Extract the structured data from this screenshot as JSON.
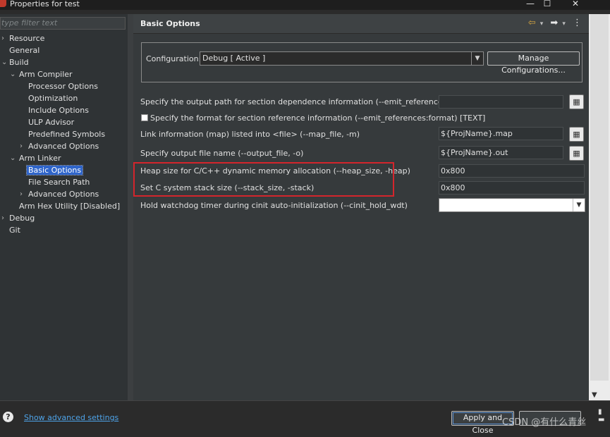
{
  "window": {
    "title": "Properties for test",
    "minimize": "—",
    "maximize": "☐",
    "close": "✕"
  },
  "sidebar": {
    "filter_placeholder": "type filter text",
    "items": [
      {
        "label": "Resource",
        "twisty": "›"
      },
      {
        "label": "General",
        "twisty": ""
      },
      {
        "label": "Build",
        "twisty": "⌄"
      },
      {
        "label": "Arm Compiler",
        "twisty": "⌄"
      },
      {
        "label": "Processor Options",
        "twisty": ""
      },
      {
        "label": "Optimization",
        "twisty": ""
      },
      {
        "label": "Include Options",
        "twisty": ""
      },
      {
        "label": "ULP Advisor",
        "twisty": ""
      },
      {
        "label": "Predefined Symbols",
        "twisty": ""
      },
      {
        "label": "Advanced Options",
        "twisty": "›"
      },
      {
        "label": "Arm Linker",
        "twisty": "⌄"
      },
      {
        "label": "Basic Options",
        "twisty": ""
      },
      {
        "label": "File Search Path",
        "twisty": ""
      },
      {
        "label": "Advanced Options",
        "twisty": "›"
      },
      {
        "label": "Arm Hex Utility  [Disabled]",
        "twisty": ""
      },
      {
        "label": "Debug",
        "twisty": "›"
      },
      {
        "label": "Git",
        "twisty": ""
      }
    ]
  },
  "main": {
    "title": "Basic Options",
    "nav": {
      "back": "⇦",
      "forward": "➡",
      "menu": "⋮",
      "dropdown": "▾"
    },
    "configuration": {
      "label": "Configuration:",
      "value": "Debug  [ Active ]",
      "manage_button": "Manage Configurations..."
    },
    "options": {
      "emit_references_label": "Specify the output path for section dependence information (--emit_references:file)",
      "emit_references_value": "",
      "format_label": "Specify the format for section reference information (--emit_references:format) [TEXT]",
      "map_label": "Link information (map) listed into <file> (--map_file, -m)",
      "map_value": "${ProjName}.map",
      "output_label": "Specify output file name (--output_file, -o)",
      "output_value": "${ProjName}.out",
      "heap_label": "Heap size for C/C++ dynamic memory allocation (--heap_size, -heap)",
      "heap_value": "0x800",
      "stack_label": "Set C system stack size (--stack_size, -stack)",
      "stack_value": "0x800",
      "watchdog_label": "Hold watchdog timer during cinit auto-initialization (--cinit_hold_wdt)",
      "watchdog_value": ""
    },
    "variable_button_glyph": "▦"
  },
  "footer": {
    "help": "?",
    "advanced_link": "Show advanced settings",
    "apply_close": "Apply and Close",
    "watermark": "CSDN @有什么青丝"
  },
  "colors": {
    "highlight_border": "#d4252c",
    "selection": "#2f65ca",
    "link": "#4ea3e8"
  }
}
